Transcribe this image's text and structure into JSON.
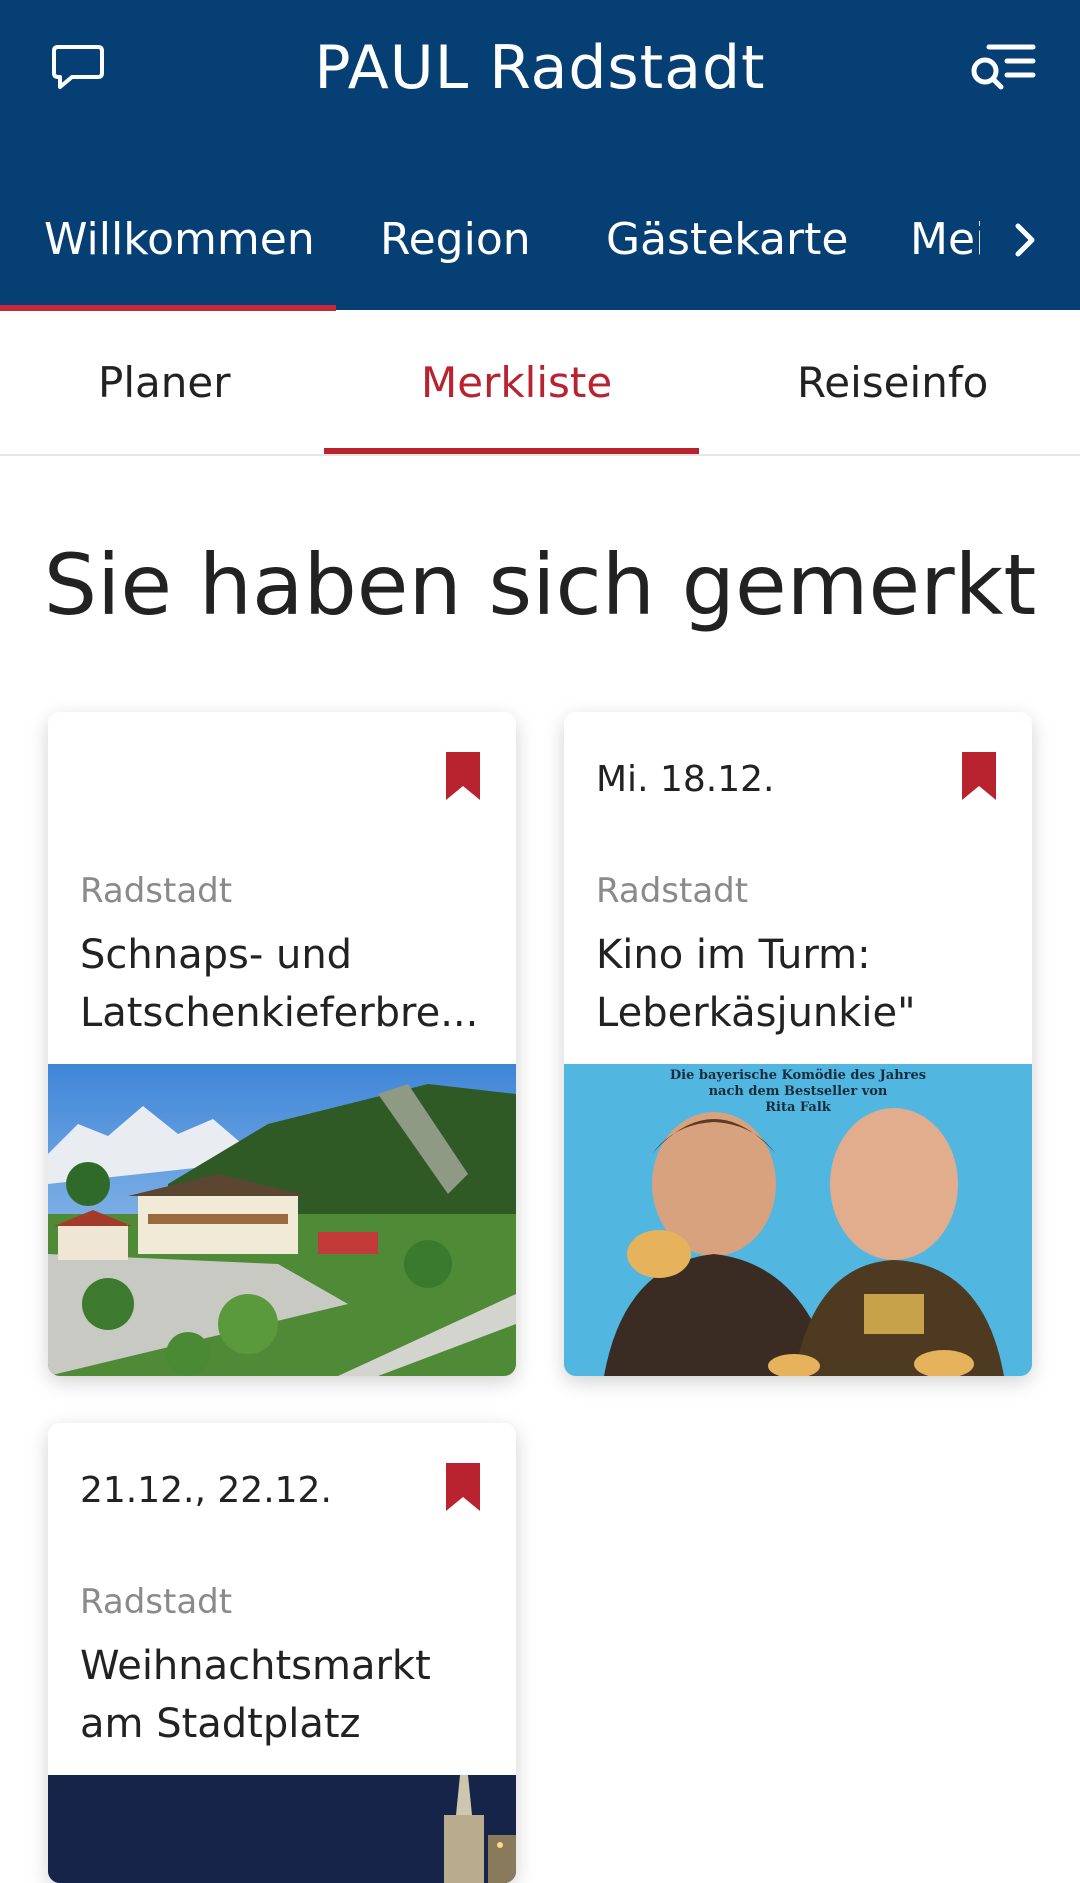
{
  "header": {
    "title": "PAUL Radstadt",
    "chat_icon": "chat-bubble-icon",
    "search_menu_icon": "search-list-icon"
  },
  "main_tabs": [
    {
      "label": "Willkommen",
      "active": true
    },
    {
      "label": "Region",
      "active": false
    },
    {
      "label": "Gästekarte",
      "active": false
    },
    {
      "label": "Mei",
      "active": false
    }
  ],
  "sub_tabs": [
    {
      "label": "Planer",
      "active": false
    },
    {
      "label": "Merkliste",
      "active": true
    },
    {
      "label": "Reiseinfo",
      "active": false
    }
  ],
  "section_title": "Sie haben sich gemerkt",
  "cards": [
    {
      "date": "",
      "location": "Radstadt",
      "title_line1": "Schnaps- und",
      "title_line2": "Latschenkieferbre...",
      "bookmarked": true
    },
    {
      "date": "Mi. 18.12.",
      "location": "Radstadt",
      "title_line1": "Kino im Turm:",
      "title_line2": "Leberkäsjunkie\"",
      "poster_text_1": "Die bayerische Komödie des Jahres",
      "poster_text_2": "nach dem Bestseller von",
      "poster_text_3": "Rita Falk",
      "bookmarked": true
    },
    {
      "date": "21.12., 22.12.",
      "location": "Radstadt",
      "title_line1": "Weihnachtsmarkt",
      "title_line2": "am Stadtplatz",
      "bookmarked": true
    }
  ],
  "colors": {
    "header_bg": "#063f74",
    "accent_red": "#b8232f",
    "tab_underline": "#c62a3a"
  }
}
